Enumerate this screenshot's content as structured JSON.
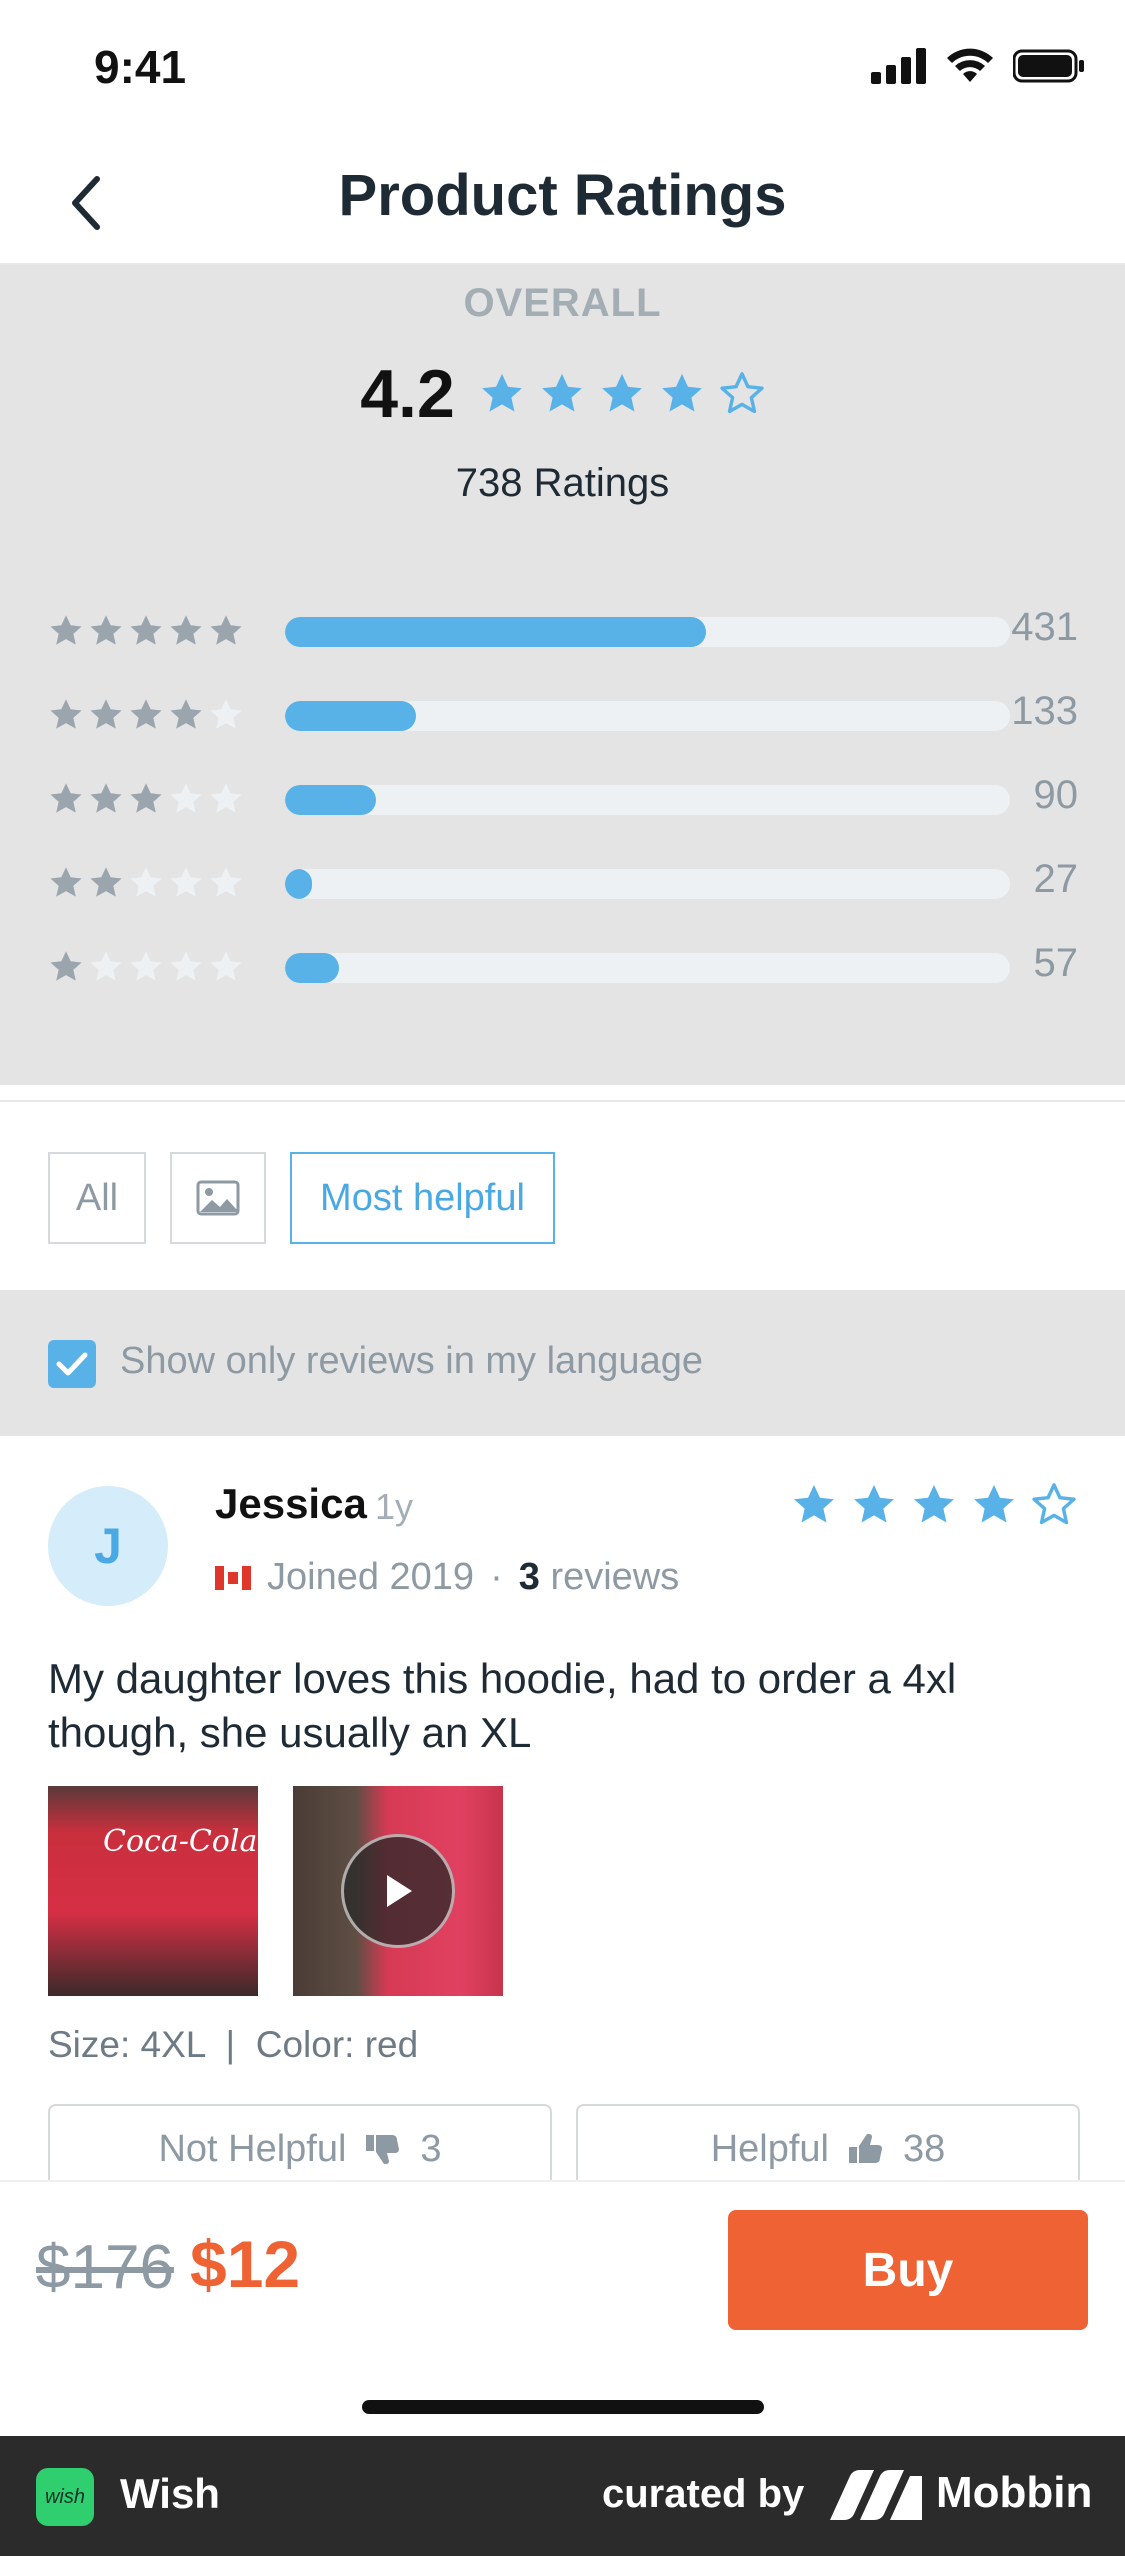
{
  "status_bar": {
    "time": "9:41"
  },
  "header": {
    "title": "Product Ratings"
  },
  "overall": {
    "label": "OVERALL",
    "score": "4.2",
    "stars_filled": 4,
    "count_label": "738 Ratings"
  },
  "distribution": [
    {
      "stars": 5,
      "count": "431",
      "fraction": 0.58
    },
    {
      "stars": 4,
      "count": "133",
      "fraction": 0.18
    },
    {
      "stars": 3,
      "count": "90",
      "fraction": 0.125
    },
    {
      "stars": 2,
      "count": "27",
      "fraction": 0.037
    },
    {
      "stars": 1,
      "count": "57",
      "fraction": 0.075
    }
  ],
  "filters": {
    "all_label": "All",
    "images_icon": "image-icon",
    "most_helpful_label": "Most helpful",
    "active": "most_helpful"
  },
  "language_filter": {
    "checked": true,
    "label": "Show only reviews in my language"
  },
  "review": {
    "avatar_initial": "J",
    "name": "Jessica",
    "age": "1y",
    "joined": "Joined 2019",
    "separator": "·",
    "review_count": "3",
    "reviews_word": "reviews",
    "stars_filled": 4,
    "text": "My daughter loves this hoodie, had to order a 4xl though, she usually an XL",
    "thumb_logo_text": "Coca-Cola",
    "size_line": "Size: 4XL  |  Color: red",
    "not_helpful_label": "Not Helpful",
    "not_helpful_count": "3",
    "helpful_label": "Helpful",
    "helpful_count": "38"
  },
  "buy_bar": {
    "old_price": "$176",
    "new_price": "$12",
    "buy_label": "Buy"
  },
  "footer": {
    "app_name": "Wish",
    "app_logo_text": "wish",
    "curated_by": "curated by",
    "brand": "Mobbin"
  },
  "colors": {
    "accent_blue": "#58b2e8",
    "buy_orange": "#ee6233",
    "muted_gray": "#8e9aa3"
  }
}
